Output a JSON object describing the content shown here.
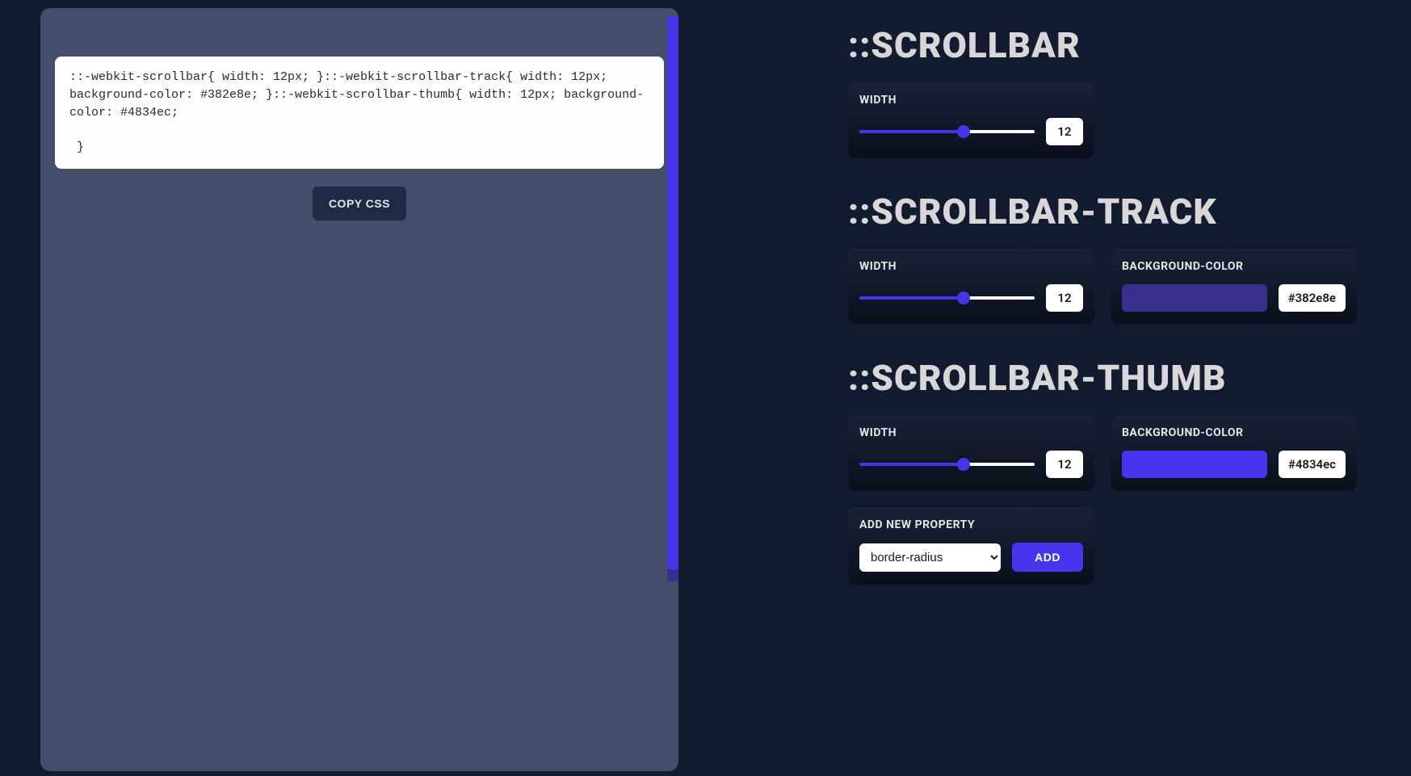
{
  "preview": {
    "css_output": "::-webkit-scrollbar{ width: 12px; }::-webkit-scrollbar-track{ width: 12px; background-color: #382e8e; }::-webkit-scrollbar-thumb{ width: 12px; background-color: #4834ec;\n\n }",
    "copy_button_label": "COPY CSS"
  },
  "sections": {
    "scrollbar": {
      "title": "::SCROLLBAR",
      "width": {
        "label": "WIDTH",
        "value": "12"
      }
    },
    "track": {
      "title": "::SCROLLBAR-TRACK",
      "width": {
        "label": "WIDTH",
        "value": "12"
      },
      "bg": {
        "label": "BACKGROUND-COLOR",
        "value": "#382e8e"
      }
    },
    "thumb": {
      "title": "::SCROLLBAR-THUMB",
      "width": {
        "label": "WIDTH",
        "value": "12"
      },
      "bg": {
        "label": "BACKGROUND-COLOR",
        "value": "#4834ec"
      },
      "add": {
        "label": "ADD NEW PROPERTY",
        "selected": "border-radius",
        "button": "ADD"
      }
    }
  },
  "colors": {
    "track_bg": "#382e8e",
    "thumb_bg": "#4834ec"
  }
}
